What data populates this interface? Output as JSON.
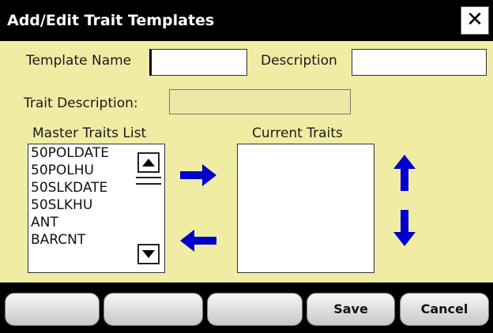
{
  "window": {
    "title": "Add/Edit Trait Templates",
    "close_glyph": "✕"
  },
  "form": {
    "template_name_label": "Template Name",
    "template_name_value": "",
    "description_label": "Description",
    "description_value": "",
    "trait_description_label": "Trait Description:",
    "trait_description_value": ""
  },
  "master_list": {
    "label": "Master Traits List",
    "items": [
      "50POLDATE",
      "50POLHU",
      "50SLKDATE",
      "50SLKHU",
      "ANT",
      "BARCNT"
    ]
  },
  "current_list": {
    "label": "Current Traits",
    "items": []
  },
  "icons": {
    "add_arrow": "arrow-right-icon",
    "remove_arrow": "arrow-left-icon",
    "move_up": "arrow-up-icon",
    "move_down": "arrow-down-icon",
    "arrow_color": "#0000cc"
  },
  "buttons": [
    "",
    "",
    "",
    "Save",
    "Cancel"
  ]
}
